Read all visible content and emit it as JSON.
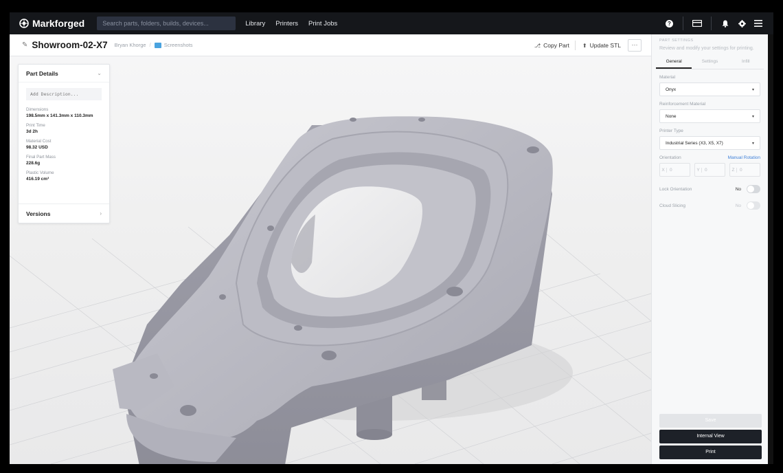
{
  "topnav": {
    "brand": "Markforged",
    "search_placeholder": "Search parts, folders, builds, devices...",
    "links": [
      "Library",
      "Printers",
      "Print Jobs"
    ]
  },
  "subheader": {
    "part_name": "Showroom-02-X7",
    "author": "Bryan Khorge",
    "folder": "Screenshots",
    "copy_label": "Copy Part",
    "update_label": "Update STL",
    "more_label": "···"
  },
  "part_details": {
    "title": "Part Details",
    "description_placeholder": "Add Description...",
    "details": [
      {
        "label": "Dimensions",
        "value": "198.5mm x 141.3mm x 110.3mm"
      },
      {
        "label": "Print Time",
        "value": "3d 2h"
      },
      {
        "label": "Material Cost",
        "value": "98.32 USD"
      },
      {
        "label": "Final Part Mass",
        "value": "228.6g"
      },
      {
        "label": "Plastic Volume",
        "value": "416.19 cm³"
      }
    ],
    "versions_label": "Versions"
  },
  "panel": {
    "kicker": "PART SETTINGS",
    "subtitle": "Review and modify your settings for printing.",
    "tabs": [
      "General",
      "Settings",
      "Infill"
    ],
    "material_label": "Material",
    "material_value": "Onyx",
    "reinforcement_label": "Reinforcement Material",
    "reinforcement_value": "None",
    "printer_label": "Printer Type",
    "printer_value": "Industrial Series (X3, X5, X7)",
    "orientation_label": "Orientation",
    "manual_rotation": "Manual Rotation",
    "axes": [
      {
        "axis": "X",
        "value": "0"
      },
      {
        "axis": "Y",
        "value": "0"
      },
      {
        "axis": "Z",
        "value": "0"
      }
    ],
    "lock_label": "Lock Orientation",
    "lock_state": "No",
    "cloud_label": "Cloud Slicing",
    "cloud_state": "No",
    "save_label": "Save",
    "internal_label": "Internal View",
    "print_label": "Print"
  },
  "colors": {
    "nav_bg": "#15171b",
    "part_gray": "#b3b3bd",
    "link_blue": "#3d7fd8",
    "button_dark": "#1d2128"
  }
}
